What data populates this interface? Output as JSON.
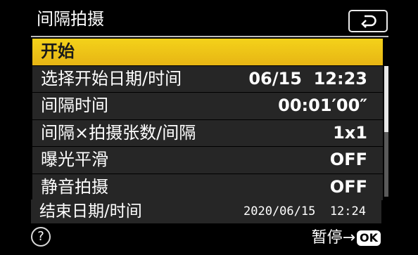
{
  "header": {
    "title": "间隔拍摄",
    "back_icon": "return-arrow-icon"
  },
  "menu": {
    "items": [
      {
        "label": "开始",
        "value": "",
        "selected": true
      },
      {
        "label": "选择开始日期/时间",
        "value": "06/15  12:23",
        "selected": false
      },
      {
        "label": "间隔时间",
        "value": "00:01′00″",
        "selected": false
      },
      {
        "label": "间隔×拍摄张数/间隔",
        "value": "1x1",
        "selected": false
      },
      {
        "label": "曝光平滑",
        "value": "OFF",
        "selected": false
      },
      {
        "label": "静音拍摄",
        "value": "OFF",
        "selected": false
      }
    ]
  },
  "footer": {
    "end_label": "结束日期/时间",
    "end_value": "2020/06/15  12:24",
    "help_glyph": "?",
    "pause_label": "暂停→",
    "ok_label": "OK"
  },
  "colors": {
    "accent": "#f0c419",
    "row_bg": "#262626",
    "background": "#000000"
  }
}
